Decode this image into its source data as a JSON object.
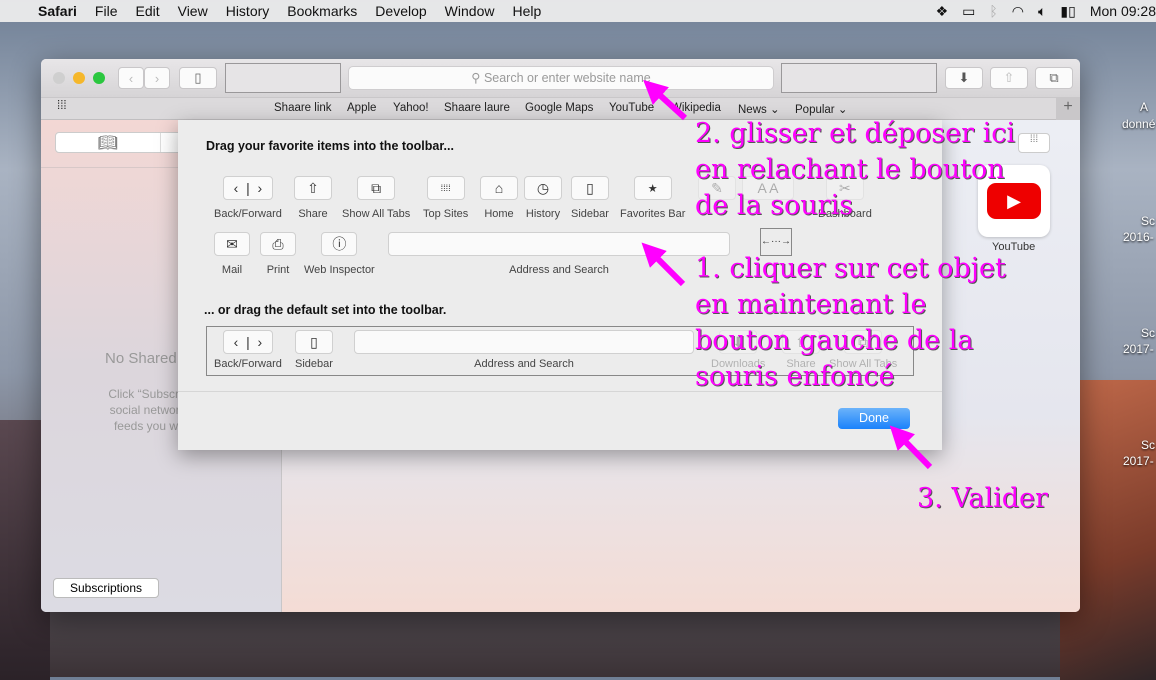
{
  "menubar": {
    "app": "Safari",
    "items": [
      "File",
      "Edit",
      "View",
      "History",
      "Bookmarks",
      "Develop",
      "Window",
      "Help"
    ],
    "clock": "Mon 09:28"
  },
  "toolbar": {
    "address_placeholder": "Search or enter website name"
  },
  "favorites": [
    "Shaare link",
    "Apple",
    "Yahoo!",
    "Shaare laure",
    "Google Maps",
    "YouTube",
    "Wikipedia",
    "News",
    "Popular"
  ],
  "sidebar": {
    "no_shared": "No Shared",
    "hint": [
      "Click “Subscriptions",
      "social network, app",
      "feeds you want to"
    ],
    "subscriptions_button": "Subscriptions"
  },
  "content": {
    "youtube_label": "YouTube"
  },
  "customize": {
    "heading1": "Drag your favorite items into the toolbar...",
    "heading2": "... or drag the default set into the toolbar.",
    "items": {
      "back_forward": "Back/Forward",
      "share": "Share",
      "show_all_tabs": "Show All Tabs",
      "top_sites": "Top Sites",
      "home": "Home",
      "history": "History",
      "sidebar": "Sidebar",
      "favorites_bar": "Favorites Bar",
      "dashboard": "Dashboard",
      "mail": "Mail",
      "print": "Print",
      "web_inspector": "Web Inspector",
      "address_search": "Address and Search"
    },
    "default_set": {
      "back_forward": "Back/Forward",
      "sidebar": "Sidebar",
      "address_search": "Address and Search",
      "downloads": "Downloads",
      "share": "Share",
      "show_all_tabs": "Show All Tabs"
    },
    "done": "Done"
  },
  "desktop": {
    "labels": [
      "A",
      "donné",
      "Sc",
      "2016-",
      "Sc",
      "2017-",
      "Sc",
      "2017-"
    ]
  },
  "annotations": {
    "step2": [
      "2. glisser et déposer ici",
      "en relachant le bouton",
      "de la souris"
    ],
    "step1": [
      "1. cliquer sur cet objet",
      "en maintenant le",
      "bouton gauche de la",
      "souris enfoncé"
    ],
    "step3": "3. Valider",
    "color": "#ff00ff"
  }
}
